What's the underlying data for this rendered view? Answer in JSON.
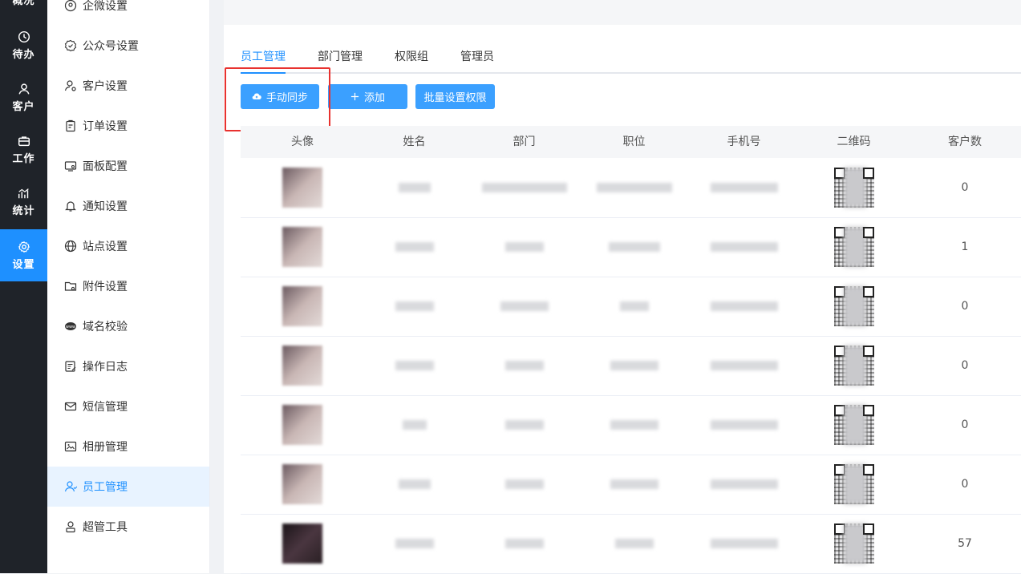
{
  "rail": {
    "items": [
      {
        "label": "概况",
        "icon": "overview-icon"
      },
      {
        "label": "待办",
        "icon": "clock-icon"
      },
      {
        "label": "客户",
        "icon": "user-icon"
      },
      {
        "label": "工作",
        "icon": "briefcase-icon"
      },
      {
        "label": "统计",
        "icon": "chart-icon"
      },
      {
        "label": "设置",
        "icon": "gear-icon"
      }
    ],
    "active": "设置"
  },
  "menu": {
    "items": [
      {
        "label": "企微设置",
        "icon": "wecom-icon"
      },
      {
        "label": "公众号设置",
        "icon": "badge-check-icon"
      },
      {
        "label": "客户设置",
        "icon": "user-gear-icon"
      },
      {
        "label": "订单设置",
        "icon": "clipboard-icon"
      },
      {
        "label": "面板配置",
        "icon": "panel-icon"
      },
      {
        "label": "通知设置",
        "icon": "bell-icon"
      },
      {
        "label": "站点设置",
        "icon": "globe-icon"
      },
      {
        "label": "附件设置",
        "icon": "folder-icon"
      },
      {
        "label": "域名校验",
        "icon": "www-icon"
      },
      {
        "label": "操作日志",
        "icon": "log-icon"
      },
      {
        "label": "短信管理",
        "icon": "mail-icon"
      },
      {
        "label": "相册管理",
        "icon": "photo-icon"
      },
      {
        "label": "员工管理",
        "icon": "staff-icon"
      },
      {
        "label": "超管工具",
        "icon": "admin-icon"
      }
    ],
    "active": "员工管理"
  },
  "tabs": [
    "员工管理",
    "部门管理",
    "权限组",
    "管理员"
  ],
  "active_tab": "员工管理",
  "buttons": {
    "sync": "手动同步",
    "add": "添加",
    "batch": "批量设置权限"
  },
  "table": {
    "columns": [
      "头像",
      "姓名",
      "部门",
      "职位",
      "手机号",
      "二维码",
      "客户数"
    ],
    "rows": [
      {
        "customers": "0"
      },
      {
        "customers": "1"
      },
      {
        "customers": "0"
      },
      {
        "customers": "0"
      },
      {
        "customers": "0"
      },
      {
        "customers": "0"
      },
      {
        "customers": "57"
      }
    ]
  },
  "colors": {
    "rail_bg": "#1f2329",
    "accent": "#1e90ff",
    "button": "#3ba0ff",
    "highlight_border": "#e8322f"
  }
}
